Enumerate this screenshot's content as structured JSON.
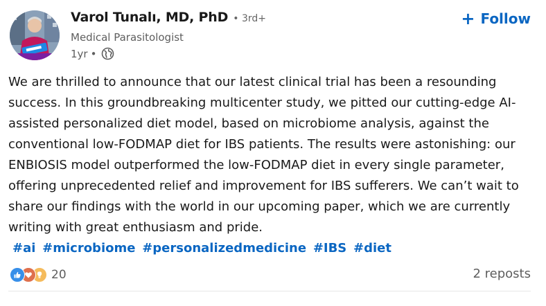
{
  "author": {
    "name": "Varol Tunalı, MD, PhD",
    "degree": "• 3rd+",
    "headline": "Medical Parasitologist",
    "age": "1yr",
    "separator": "•",
    "visibility_icon": "globe-icon"
  },
  "follow": {
    "plus": "+",
    "label": "Follow"
  },
  "post": {
    "lines": [
      "We are thrilled to announce that our latest clinical trial has been a resounding",
      "success. In this groundbreaking multicenter study, we pitted our cutting-edge AI-",
      "assisted personalized diet model, based on microbiome analysis, against the",
      "conventional low-FODMAP diet for IBS patients. The results were astonishing: our",
      "ENBIOSIS model outperformed the low-FODMAP diet in every single parameter,",
      "offering unprecedented relief and improvement for IBS sufferers. We can’t wait to",
      "share our findings with the world in our upcoming paper, which we are currently",
      "writing with great enthusiasm and pride."
    ],
    "hashtags": [
      "#ai",
      "#microbiome",
      "#personalizedmedicine",
      "#IBS",
      "#diet"
    ]
  },
  "social": {
    "reaction_icons": [
      "like-icon",
      "love-icon",
      "insightful-icon"
    ],
    "reaction_count": "20",
    "reposts": "2 reposts"
  },
  "colors": {
    "accent": "#0a66c2",
    "text": "#191919",
    "muted": "#5e5e5e",
    "like": "#378fe9",
    "love": "#df704d",
    "insightful": "#f5bb5c"
  }
}
